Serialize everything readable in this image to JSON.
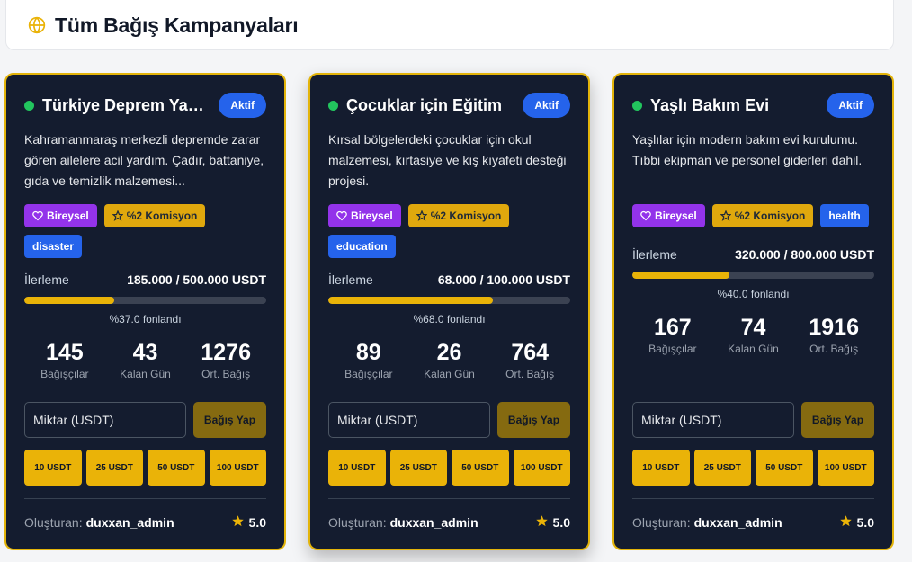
{
  "header": {
    "title": "Tüm Bağış Kampanyaları",
    "icon": "globe-icon"
  },
  "colors": {
    "accent": "#eab308",
    "card_bg": "#141c2f",
    "status_blue": "#2563eb",
    "tag_purple": "#9333ea",
    "live_green": "#22c55e"
  },
  "campaigns": [
    {
      "title": "Türkiye Deprem Yardım Kampanyası",
      "status": "Aktif",
      "description": "Kahramanmaraş merkezli depremde zarar gören ailelere acil yardım. Çadır, battaniye, gıda ve temizlik malzemesi...",
      "tags": [
        "Bireysel",
        "%2 Komisyon",
        "disaster"
      ],
      "progress_label": "İlerleme",
      "progress_value": "185.000 / 500.000 USDT",
      "progress_percent": 37,
      "funded_text": "%37.0 fonlandı",
      "stats": [
        {
          "num": "145",
          "label": "Bağışçılar"
        },
        {
          "num": "43",
          "label": "Kalan Gün"
        },
        {
          "num": "1276",
          "label": "Ort. Bağış"
        }
      ],
      "amount_placeholder": "Miktar (USDT)",
      "donate_label": "Bağış Yap",
      "quick_amounts": [
        "10 USDT",
        "25 USDT",
        "50 USDT",
        "100 USDT"
      ],
      "creator_label": "Oluşturan:",
      "creator_name": "duxxan_admin",
      "rating": "5.0"
    },
    {
      "title": "Çocuklar için Eğitim",
      "status": "Aktif",
      "description": "Kırsal bölgelerdeki çocuklar için okul malzemesi, kırtasiye ve kış kıyafeti desteği projesi.",
      "tags": [
        "Bireysel",
        "%2 Komisyon",
        "education"
      ],
      "progress_label": "İlerleme",
      "progress_value": "68.000 / 100.000 USDT",
      "progress_percent": 68,
      "funded_text": "%68.0 fonlandı",
      "stats": [
        {
          "num": "89",
          "label": "Bağışçılar"
        },
        {
          "num": "26",
          "label": "Kalan Gün"
        },
        {
          "num": "764",
          "label": "Ort. Bağış"
        }
      ],
      "amount_placeholder": "Miktar (USDT)",
      "donate_label": "Bağış Yap",
      "quick_amounts": [
        "10 USDT",
        "25 USDT",
        "50 USDT",
        "100 USDT"
      ],
      "creator_label": "Oluşturan:",
      "creator_name": "duxxan_admin",
      "rating": "5.0"
    },
    {
      "title": "Yaşlı Bakım Evi",
      "status": "Aktif",
      "description": "Yaşlılar için modern bakım evi kurulumu. Tıbbi ekipman ve personel giderleri dahil.",
      "tags": [
        "Bireysel",
        "%2 Komisyon",
        "health"
      ],
      "progress_label": "İlerleme",
      "progress_value": "320.000 / 800.000 USDT",
      "progress_percent": 40,
      "funded_text": "%40.0 fonlandı",
      "stats": [
        {
          "num": "167",
          "label": "Bağışçılar"
        },
        {
          "num": "74",
          "label": "Kalan Gün"
        },
        {
          "num": "1916",
          "label": "Ort. Bağış"
        }
      ],
      "amount_placeholder": "Miktar (USDT)",
      "donate_label": "Bağış Yap",
      "quick_amounts": [
        "10 USDT",
        "25 USDT",
        "50 USDT",
        "100 USDT"
      ],
      "creator_label": "Oluşturan:",
      "creator_name": "duxxan_admin",
      "rating": "5.0"
    }
  ]
}
